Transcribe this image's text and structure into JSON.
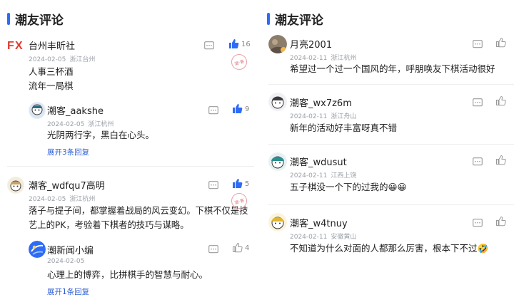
{
  "left": {
    "section_title": "潮友评论",
    "comments": [
      {
        "name": "台州丰昕社",
        "date": "2024-02-05",
        "location": "浙江台州",
        "lines": [
          "人事三杯酒",
          "流年一局棋"
        ],
        "likes": "16",
        "liked": true,
        "avatar": "fx-logo-avatar",
        "reply": {
          "name": "潮客_aakshe",
          "date": "2024-02-05",
          "location": "浙江杭州",
          "text": "光阴两行字，黑白在心头。",
          "likes": "9",
          "liked": true,
          "more": "展开3条回复",
          "avatar": "cartoon-avatar"
        }
      },
      {
        "name": "潮客_wdfqu7高明",
        "date": "2024-02-05",
        "location": "浙江杭州",
        "text": "落子与提子间，都掌握着战局的风云变幻。下棋不仅是技艺上的PK，考验着下棋者的技巧与谋略。",
        "likes": "5",
        "liked": true,
        "avatar": "cartoon-avatar",
        "reply": {
          "name": "潮新闻小编",
          "date": "2024-02-05",
          "location": "",
          "text": "心理上的博弈，比拼棋手的智慧与耐心。",
          "likes": "4",
          "liked": false,
          "more": "展开1条回复",
          "avatar": "news-logo-avatar"
        }
      }
    ]
  },
  "right": {
    "section_title": "潮友评论",
    "comments": [
      {
        "name": "月亮2001",
        "date": "2024-02-11",
        "location": "浙江杭州",
        "text": "希望过一个过一个国风的年，呼朋唤友下棋活动很好",
        "avatar": "photo-avatar"
      },
      {
        "name": "潮客_wx7z6m",
        "date": "2024-02-11",
        "location": "浙江舟山",
        "text": "新年的活动好丰富呀真不错",
        "avatar": "cartoon-avatar"
      },
      {
        "name": "潮客_wdusut",
        "date": "2024-02-11",
        "location": "江西上饶",
        "text": "五子棋没一个下的过我的😀😀",
        "avatar": "cartoon-avatar"
      },
      {
        "name": "潮客_w4tnuy",
        "date": "2024-02-11",
        "location": "安徽黄山",
        "text": "不知道为什么对面的人都那么厉害，根本下不过🤣",
        "avatar": "cartoon-avatar"
      }
    ]
  },
  "stamp_text": "潮·客",
  "colors": {
    "accent": "#2f6cf5",
    "link": "#2f5fd6",
    "meta": "#9aa0a8"
  }
}
